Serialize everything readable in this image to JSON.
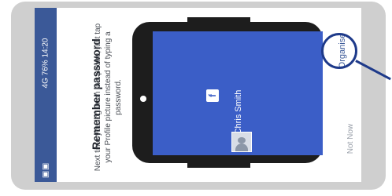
{
  "status_bar": {
    "time": "4G 76% 14:20",
    "notification_icons": "▣ ▣"
  },
  "dialog": {
    "title": "Remember password",
    "description": "Next time you log in on this phone, just tap your Profile picture instead of typing a password."
  },
  "profile": {
    "name": "Chris Smith",
    "logo_letter": "f"
  },
  "actions": {
    "not_now": "Not Now",
    "organise": "Organise"
  },
  "colors": {
    "facebook_blue": "#3b5998",
    "screen_blue": "#3b5ec7",
    "highlight": "#1e3a8a"
  }
}
